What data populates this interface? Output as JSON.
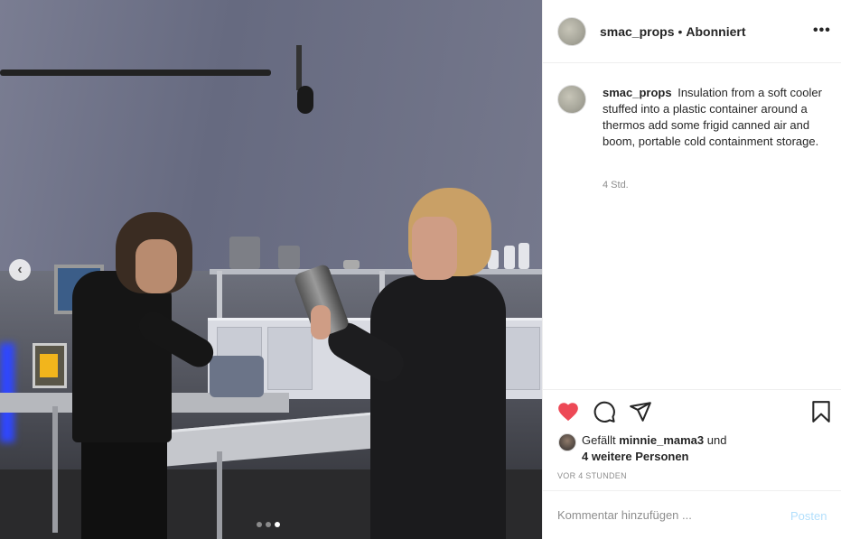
{
  "post": {
    "username": "smac_props",
    "separator": "•",
    "follow_status": "Abonniert",
    "more_label": "•••",
    "caption_text": "Insulation from a soft cooler stuffed into a plastic container around a thermos add some frigid canned air and boom, portable cold containment storage.",
    "caption_time": "4 Std."
  },
  "media": {
    "prev_label": "‹",
    "carousel_total": 3,
    "carousel_active_index": 2
  },
  "actions": {
    "like_icon": "heart-filled",
    "like_color": "#ed4956",
    "comment_icon": "speech-bubble",
    "share_icon": "paper-plane",
    "save_icon": "bookmark"
  },
  "likes": {
    "prefix": "Gefällt",
    "user": "minnie_mama3",
    "conj": "und",
    "others": "4 weitere Personen",
    "timestamp": "VOR 4 STUNDEN"
  },
  "comment": {
    "placeholder": "Kommentar hinzufügen ...",
    "post_label": "Posten",
    "post_color": "#b2dffc"
  }
}
